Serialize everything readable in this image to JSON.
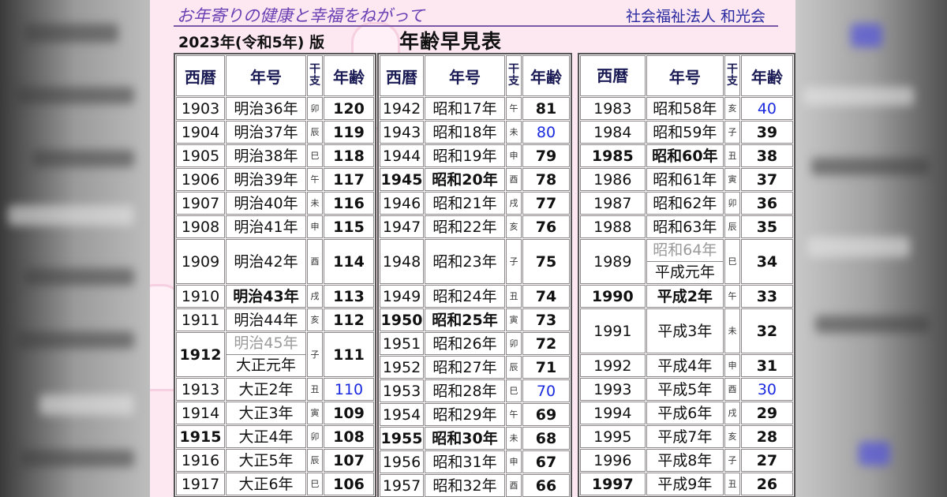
{
  "header": {
    "tagline": "お年寄りの健康と幸福をねがって",
    "organization": "社会福祉法人 和光会",
    "edition": "2023年(令和5年) 版",
    "title": "年齢早見表"
  },
  "columns": {
    "seireki": "西暦",
    "seireki_col3": "西暦",
    "nengo": "年号",
    "eto": "干支",
    "age": "年齢"
  },
  "panels": [
    {
      "rows": [
        {
          "year": "1903",
          "era": "明治36年",
          "eto": "卯",
          "age": "120"
        },
        {
          "year": "1904",
          "era": "明治37年",
          "eto": "辰",
          "age": "119"
        },
        {
          "year": "1905",
          "era": "明治38年",
          "eto": "巳",
          "age": "118"
        },
        {
          "year": "1906",
          "era": "明治39年",
          "eto": "午",
          "age": "117"
        },
        {
          "year": "1907",
          "era": "明治40年",
          "eto": "未",
          "age": "116"
        },
        {
          "year": "1908",
          "era": "明治41年",
          "eto": "申",
          "age": "115"
        },
        {
          "year": "1909",
          "era": "明治42年",
          "eto": "酉",
          "age": "114",
          "tall": true
        },
        {
          "year": "1910",
          "era": "明治43年",
          "eto": "戌",
          "age": "113",
          "era_bold": true
        },
        {
          "year": "1911",
          "era": "明治44年",
          "eto": "亥",
          "age": "112"
        },
        {
          "year": "1912",
          "era": "明治45年",
          "era2": "大正元年",
          "eto": "子",
          "age": "111",
          "split": true,
          "year_bold": true
        },
        {
          "year": "1913",
          "era": "大正2年",
          "eto": "丑",
          "age": "110",
          "blue": true
        },
        {
          "year": "1914",
          "era": "大正3年",
          "eto": "寅",
          "age": "109"
        },
        {
          "year": "1915",
          "era": "大正4年",
          "eto": "卯",
          "age": "108",
          "year_bold": true
        },
        {
          "year": "1916",
          "era": "大正5年",
          "eto": "辰",
          "age": "107"
        },
        {
          "year": "1917",
          "era": "大正6年",
          "eto": "巳",
          "age": "106"
        }
      ]
    },
    {
      "rows": [
        {
          "year": "1942",
          "era": "昭和17年",
          "eto": "午",
          "age": "81"
        },
        {
          "year": "1943",
          "era": "昭和18年",
          "eto": "未",
          "age": "80",
          "blue": true
        },
        {
          "year": "1944",
          "era": "昭和19年",
          "eto": "申",
          "age": "79"
        },
        {
          "year": "1945",
          "era": "昭和20年",
          "eto": "酉",
          "age": "78",
          "year_bold": true,
          "era_bold": true
        },
        {
          "year": "1946",
          "era": "昭和21年",
          "eto": "戌",
          "age": "77"
        },
        {
          "year": "1947",
          "era": "昭和22年",
          "eto": "亥",
          "age": "76"
        },
        {
          "year": "1948",
          "era": "昭和23年",
          "eto": "子",
          "age": "75",
          "tall": true
        },
        {
          "year": "1949",
          "era": "昭和24年",
          "eto": "丑",
          "age": "74"
        },
        {
          "year": "1950",
          "era": "昭和25年",
          "eto": "寅",
          "age": "73",
          "year_bold": true,
          "era_bold": true
        },
        {
          "year": "1951",
          "era": "昭和26年",
          "eto": "卯",
          "age": "72"
        },
        {
          "year": "1952",
          "era": "昭和27年",
          "eto": "辰",
          "age": "71"
        },
        {
          "year": "1953",
          "era": "昭和28年",
          "eto": "巳",
          "age": "70",
          "blue": true
        },
        {
          "year": "1954",
          "era": "昭和29年",
          "eto": "午",
          "age": "69"
        },
        {
          "year": "1955",
          "era": "昭和30年",
          "eto": "未",
          "age": "68",
          "year_bold": true,
          "era_bold": true
        },
        {
          "year": "1956",
          "era": "昭和31年",
          "eto": "申",
          "age": "67"
        },
        {
          "year": "1957",
          "era": "昭和32年",
          "eto": "酉",
          "age": "66"
        }
      ]
    },
    {
      "rows": [
        {
          "year": "1983",
          "era": "昭和58年",
          "eto": "亥",
          "age": "40",
          "blue": true
        },
        {
          "year": "1984",
          "era": "昭和59年",
          "eto": "子",
          "age": "39"
        },
        {
          "year": "1985",
          "era": "昭和60年",
          "eto": "丑",
          "age": "38",
          "year_bold": true,
          "era_bold": true
        },
        {
          "year": "1986",
          "era": "昭和61年",
          "eto": "寅",
          "age": "37"
        },
        {
          "year": "1987",
          "era": "昭和62年",
          "eto": "卯",
          "age": "36"
        },
        {
          "year": "1988",
          "era": "昭和63年",
          "eto": "辰",
          "age": "35"
        },
        {
          "year": "1989",
          "era": "昭和64年",
          "era2": "平成元年",
          "eto": "巳",
          "age": "34",
          "split": true
        },
        {
          "year": "1990",
          "era": "平成2年",
          "eto": "午",
          "age": "33",
          "year_bold": true,
          "era_bold": true
        },
        {
          "year": "1991",
          "era": "平成3年",
          "eto": "未",
          "age": "32",
          "tall": true
        },
        {
          "year": "1992",
          "era": "平成4年",
          "eto": "申",
          "age": "31"
        },
        {
          "year": "1993",
          "era": "平成5年",
          "eto": "酉",
          "age": "30",
          "blue": true
        },
        {
          "year": "1994",
          "era": "平成6年",
          "eto": "戌",
          "age": "29"
        },
        {
          "year": "1995",
          "era": "平成7年",
          "eto": "亥",
          "age": "28"
        },
        {
          "year": "1996",
          "era": "平成8年",
          "eto": "子",
          "age": "27"
        },
        {
          "year": "1997",
          "era": "平成9年",
          "eto": "丑",
          "age": "26",
          "year_bold": true
        }
      ]
    }
  ]
}
